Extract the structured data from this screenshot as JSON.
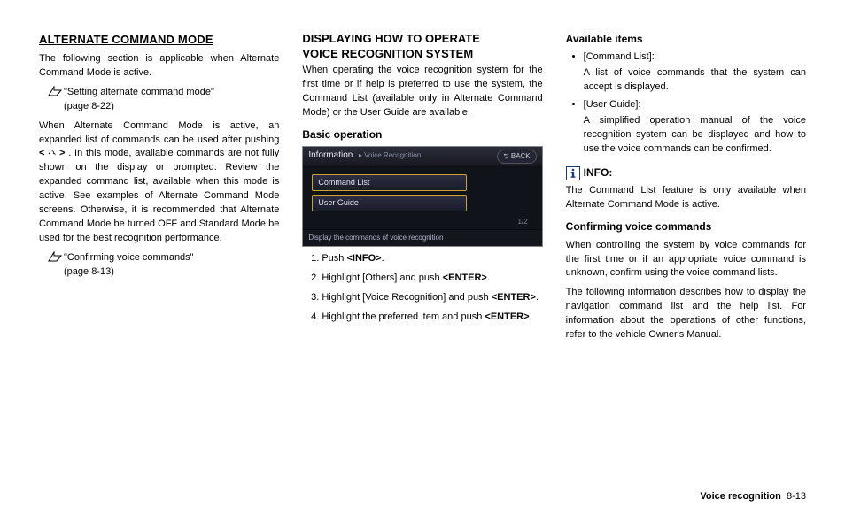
{
  "col1": {
    "heading": "ALTERNATE COMMAND MODE",
    "intro": "The following section is applicable when Alternate Command Mode is active.",
    "ref1_title": "\"Setting alternate command mode\"",
    "ref1_page": "(page 8-22)",
    "para1a": "When Alternate Command Mode is active, an expanded list of commands can be used after pushing ",
    "para1b": ". In this mode, available commands are not fully shown on the display or prompted. Review the expanded command list, available when this mode is active. See examples of Alternate Command Mode screens. Otherwise, it is recommended that Alternate Command Mode be turned OFF and Standard Mode be used for the best recognition performance.",
    "ref2_title": "\"Confirming voice commands\"",
    "ref2_page": "(page 8-13)"
  },
  "col2": {
    "heading_l1": "DISPLAYING HOW TO OPERATE",
    "heading_l2": "VOICE RECOGNITION SYSTEM",
    "intro": "When operating the voice recognition system for the first time or if help is preferred to use the system, the Command List (available only in Alternate Command Mode) or the User Guide are available.",
    "basic_heading": "Basic operation",
    "screenshot": {
      "title": "Information",
      "subtitle": "Voice Recognition",
      "back": "BACK",
      "item1": "Command List",
      "item2": "User Guide",
      "pager": "1/2",
      "footer": "Display the commands of voice recognition"
    },
    "steps": {
      "s1a": "Push ",
      "s1b": "<INFO>",
      "s1c": ".",
      "s2a": "Highlight [Others] and push ",
      "s2b": "<ENTER>",
      "s2c": ".",
      "s3a": "Highlight [Voice Recognition] and push ",
      "s3b": "<ENTER>",
      "s3c": ".",
      "s4a": "Highlight the preferred item and push ",
      "s4b": "<ENTER>",
      "s4c": "."
    }
  },
  "col3": {
    "avail_heading": "Available items",
    "b1_title": "[Command List]:",
    "b1_desc": "A list of voice commands that the system can accept is displayed.",
    "b2_title": "[User Guide]:",
    "b2_desc": "A simplified operation manual of the voice recognition system can be displayed and how to use the voice commands can be confirmed.",
    "info_label": "INFO:",
    "info_text": "The Command List feature is only available when Alternate Command Mode is active.",
    "confirm_heading": "Confirming voice commands",
    "confirm_p1": "When controlling the system by voice commands for the first time or if an appropriate voice command is unknown, confirm using the voice command lists.",
    "confirm_p2": "The following information describes how to display the navigation command list and the help list. For information about the operations of other functions, refer to the vehicle Owner's Manual."
  },
  "footer": {
    "section": "Voice recognition",
    "page": "8-13"
  }
}
